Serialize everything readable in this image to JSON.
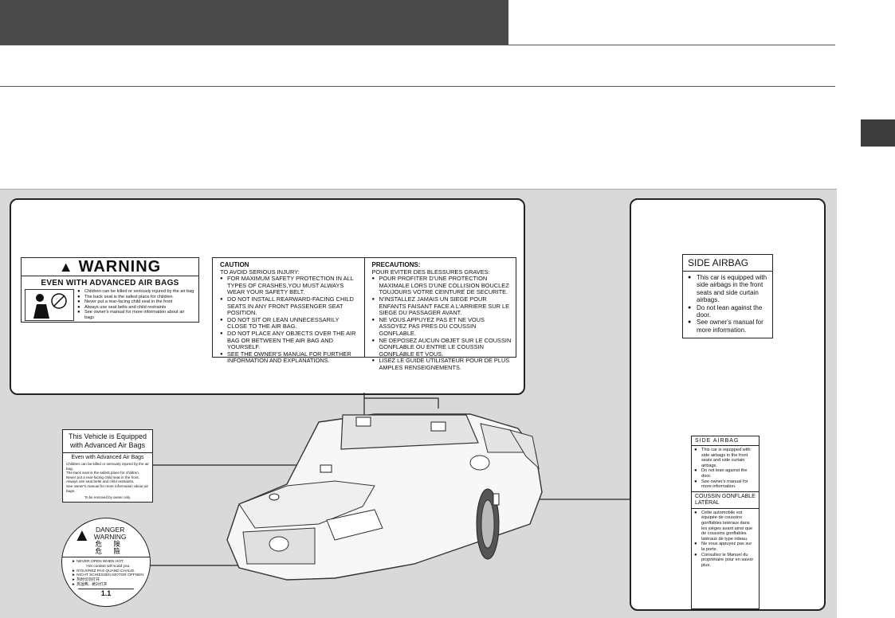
{
  "warning_label": {
    "title": "WARNING",
    "subtitle": "EVEN WITH ADVANCED AIR BAGS",
    "items": [
      "Children can be killed or seriously injured by the air bag",
      "The back seat is the safest place for children",
      "Never put a rear-facing child seat in the front",
      "Always use seat belts and child restraints",
      "See owner's manual for more information about air bags"
    ]
  },
  "caution_label": {
    "en_title": "CAUTION",
    "en_lines": [
      "TO AVOID SERIOUS INJURY:"
    ],
    "en_items": [
      "FOR MAXIMUM SAFETY PROTECTION IN ALL TYPES OF CRASHES,YOU MUST ALWAYS WEAR YOUR SAFETY BELT.",
      "DO NOT INSTALL REARWARD-FACING CHILD SEATS IN ANY FRONT PASSENGER SEAT POSITION.",
      "DO NOT SIT OR LEAN UNNECESSARILY CLOSE TO THE AIR BAG.",
      "DO NOT PLACE ANY OBJECTS OVER THE AIR BAG OR BETWEEN THE AIR BAG AND YOURSELF.",
      "SEE THE OWNER'S MANUAL FOR FURTHER INFORMATION AND EXPLANATIONS."
    ],
    "fr_title": "PRECAUTIONS:",
    "fr_lines": [
      "POUR EVITER DES BLESSURES GRAVES:"
    ],
    "fr_items": [
      "POUR PROFITER D'UNE PROTECTION MAXIMALE LORS D'UNE COLLISION BOUCLEZ TOUJOURS VOTRE CEINTURE DE SECURITE.",
      "N'INSTALLEZ JAMAIS UN SIEGE POUR ENFANTS FAISANT FACE A L'ARRIERE SUR LE SIEGE DU PASSAGER AVANT.",
      "NE VOUS APPUYEZ PAS ET NE VOUS ASSOYEZ PAS PRES DU COUSSIN GONFLABLE.",
      "NE DEPOSEZ AUCUN OBJET SUR LE COUSSIN GONFLABLE OU ENTRE LE COUSSIN GONFLABLE ET VOUS.",
      "LISEZ LE GUIDE UTILISATEUR POUR DE PLUS AMPLES RENSEIGNEMENTS."
    ]
  },
  "side_airbag_label": {
    "title": "SIDE AIRBAG",
    "items": [
      "This car is equipped with side airbags in the front seats and side curtain airbags.",
      "Do not lean against the door.",
      "See owner's manual for more information."
    ]
  },
  "side_airbag_label_bilingual": {
    "title": "SIDE AIRBAG",
    "items": [
      "This car is equipped with side airbags in the front seats and side curtain airbags.",
      "Do not lean against the door.",
      "See owner's manual for more information."
    ],
    "fr_title": "COUSSIN GONFLABLE LATÉRAL",
    "fr_items": [
      "Cette automobile est équipée de coussins gonflables latéraux dans les sièges avant ainsi que de coussins gonflables latéraux de type rideau.",
      "Ne vous appuyez pas sur la porte.",
      "Consultez le Manuel du propriétaire pour en savoir plus."
    ]
  },
  "equipped_label": {
    "title": "This Vehicle is Equipped with Advanced Air Bags",
    "subtitle": "Even with Advanced Air Bags",
    "lines": [
      "Children can be killed or seriously injured by the air bag.",
      "The back seat is the safest place for children.",
      "Never put a rear-facing child seat in the front.",
      "Always use seat belts and child restraints.",
      "See owner's manual for more information about air bags."
    ],
    "footer": "To be removed by owner only."
  },
  "danger_label": {
    "word1": "DANGER",
    "word2": "WARNING",
    "jp1": "危 険",
    "jp2": "危 險",
    "lines": [
      "► NEVER OPEN WHEN HOT.",
      "Hot coolant will scald you.",
      "► N'OUVREZ PAS QUAND CHAUD.",
      "► NICHT SCHIESSEN MOTOR OFFNEN.",
      "► 热时切勿打开",
      "► 高温時、絶対打开"
    ],
    "footer": "1.1"
  }
}
